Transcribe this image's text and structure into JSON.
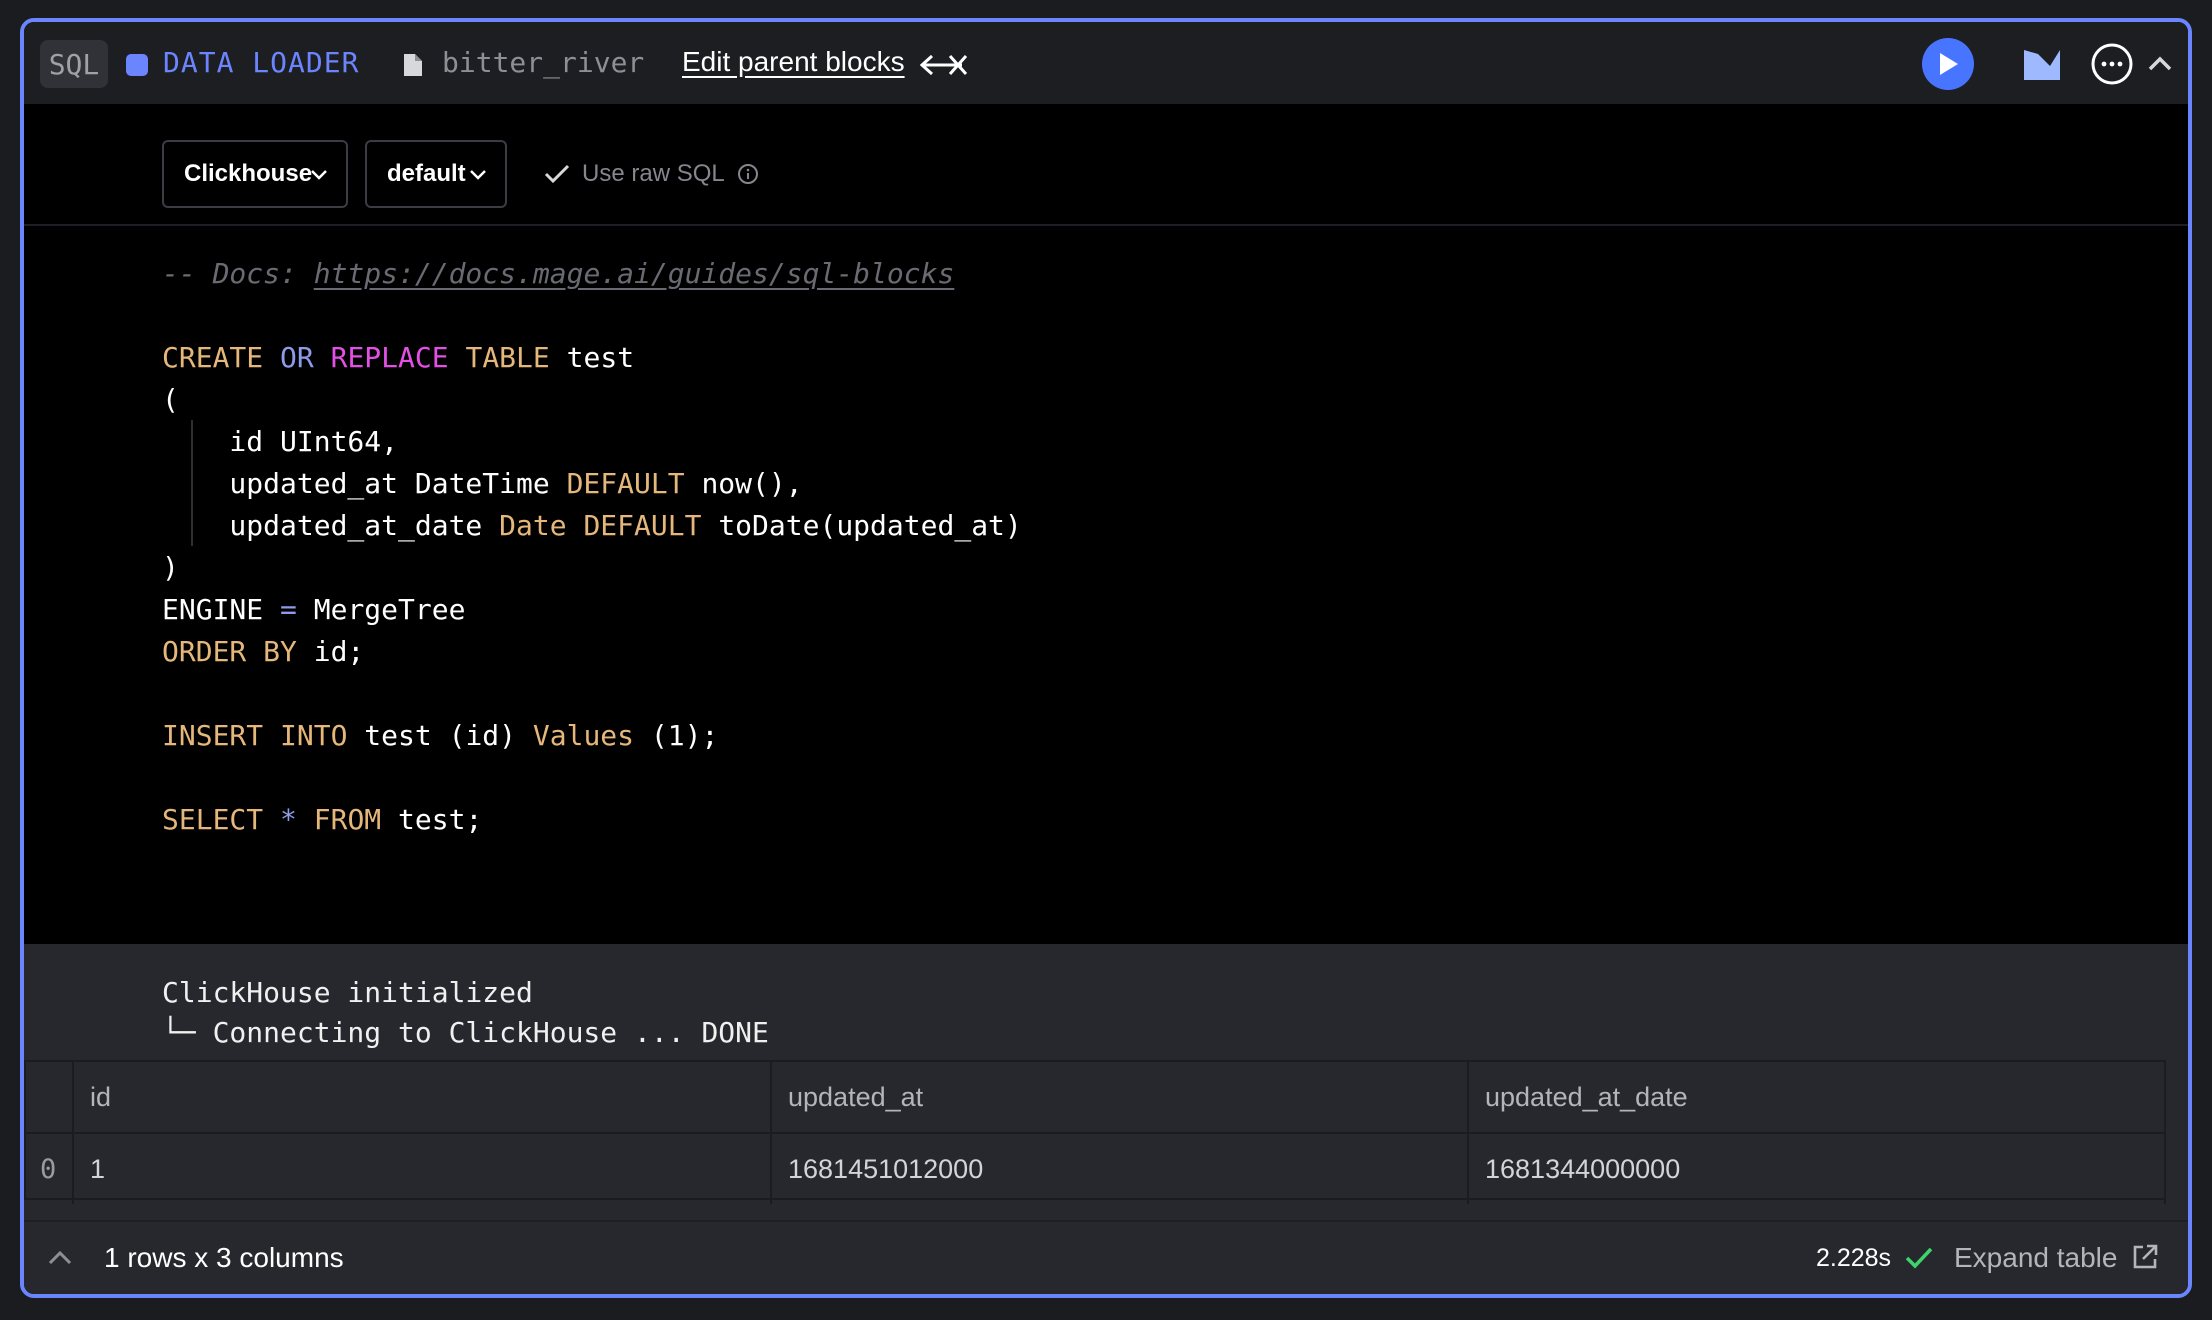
{
  "header": {
    "language": "SQL",
    "block_type": "DATA LOADER",
    "block_name": "bitter_river",
    "edit_parents_label": "Edit parent blocks",
    "colors": {
      "accent": "#6b85ff",
      "run": "#4775ff"
    }
  },
  "settings": {
    "data_provider": "Clickhouse",
    "profile": "default",
    "raw_sql_label": "Use raw SQL",
    "raw_sql_checked": true
  },
  "code": {
    "comment_prefix": "-- Docs: ",
    "docs_link": "https://docs.mage.ai/guides/sql-blocks",
    "lines": {
      "l1_kw_create": "CREATE",
      "l1_kw_or": "OR",
      "l1_kw_replace": "REPLACE",
      "l1_kw_table": "TABLE",
      "l1_name": "test",
      "l2": "(",
      "l3": "    id UInt64,",
      "l4_a": "    updated_at DateTime ",
      "l4_kw": "DEFAULT",
      "l4_b": " now(),",
      "l5_a": "    updated_at_date ",
      "l5_kw1": "Date",
      "l5_kw2": "DEFAULT",
      "l5_b": " toDate(updated_at)",
      "l6": ")",
      "l7_a": "ENGINE ",
      "l7_op": "=",
      "l7_b": " MergeTree",
      "l8_kw": "ORDER BY",
      "l8_b": " id;",
      "l9_kw": "INSERT INTO",
      "l9_a": " test (id) ",
      "l9_kw2": "Values",
      "l9_b": " (1);",
      "l10_kw": "SELECT",
      "l10_op": "*",
      "l10_kw2": "FROM",
      "l10_b": " test;"
    }
  },
  "output": {
    "line1": "ClickHouse initialized",
    "line2": "└─ Connecting to ClickHouse ... DONE",
    "table": {
      "columns": [
        "id",
        "updated_at",
        "updated_at_date"
      ],
      "rows": [
        {
          "index": "0",
          "cells": [
            "1",
            "1681451012000",
            "1681344000000"
          ]
        }
      ]
    }
  },
  "footer": {
    "row_summary": "1 rows x 3 columns",
    "duration": "2.228s",
    "expand_label": "Expand table"
  }
}
